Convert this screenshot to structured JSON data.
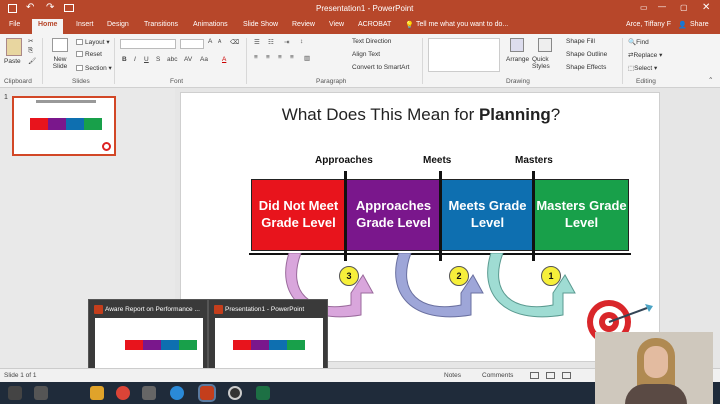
{
  "app": {
    "window_title": "Presentation1 - PowerPoint",
    "search_prompt": "Tell me what you want to do...",
    "user": "Arce, Tiffany F",
    "share_label": "Share",
    "tabs": [
      "File",
      "Home",
      "Insert",
      "Design",
      "Transitions",
      "Animations",
      "Slide Show",
      "Review",
      "View",
      "ACROBAT"
    ]
  },
  "ribbon": {
    "clipboard": {
      "paste": "Paste",
      "label": "Clipboard"
    },
    "slides": {
      "new_slide": "New Slide",
      "layout": "Layout",
      "reset": "Reset",
      "section": "Section",
      "label": "Slides"
    },
    "font": {
      "label": "Font"
    },
    "paragraph": {
      "text_direction": "Text Direction",
      "align_text": "Align Text",
      "convert": "Convert to SmartArt",
      "label": "Paragraph"
    },
    "drawing": {
      "arrange": "Arrange",
      "quick_styles": "Quick Styles",
      "shape_fill": "Shape Fill",
      "shape_outline": "Shape Outline",
      "shape_effects": "Shape Effects",
      "label": "Drawing"
    },
    "editing": {
      "find": "Find",
      "replace": "Replace",
      "select": "Select",
      "label": "Editing"
    }
  },
  "thumbnail": {
    "number": "1"
  },
  "slide": {
    "title_prefix": "What Does This Mean for ",
    "title_bold": "Planning",
    "title_suffix": "?",
    "headers": [
      "Approaches",
      "Meets",
      "Masters"
    ],
    "boxes": [
      {
        "label": "Did Not Meet Grade Level",
        "color": "#e8141c"
      },
      {
        "label": "Approaches Grade Level",
        "color": "#7a178c"
      },
      {
        "label": "Meets Grade Level",
        "color": "#0e6fb0"
      },
      {
        "label": "Masters Grade Level",
        "color": "#18a04a"
      }
    ],
    "arrows": [
      {
        "number": "3",
        "color": "#d9a6dc"
      },
      {
        "number": "2",
        "color": "#9ea6d8"
      },
      {
        "number": "1",
        "color": "#9fdcd3"
      }
    ]
  },
  "statusbar": {
    "slide_info": "Slide 1 of 1",
    "notes": "Notes",
    "comments": "Comments"
  },
  "taskbar_popups": [
    {
      "title": "Aware Report on Performance ..."
    },
    {
      "title": "Presentation1 - PowerPoint"
    }
  ]
}
